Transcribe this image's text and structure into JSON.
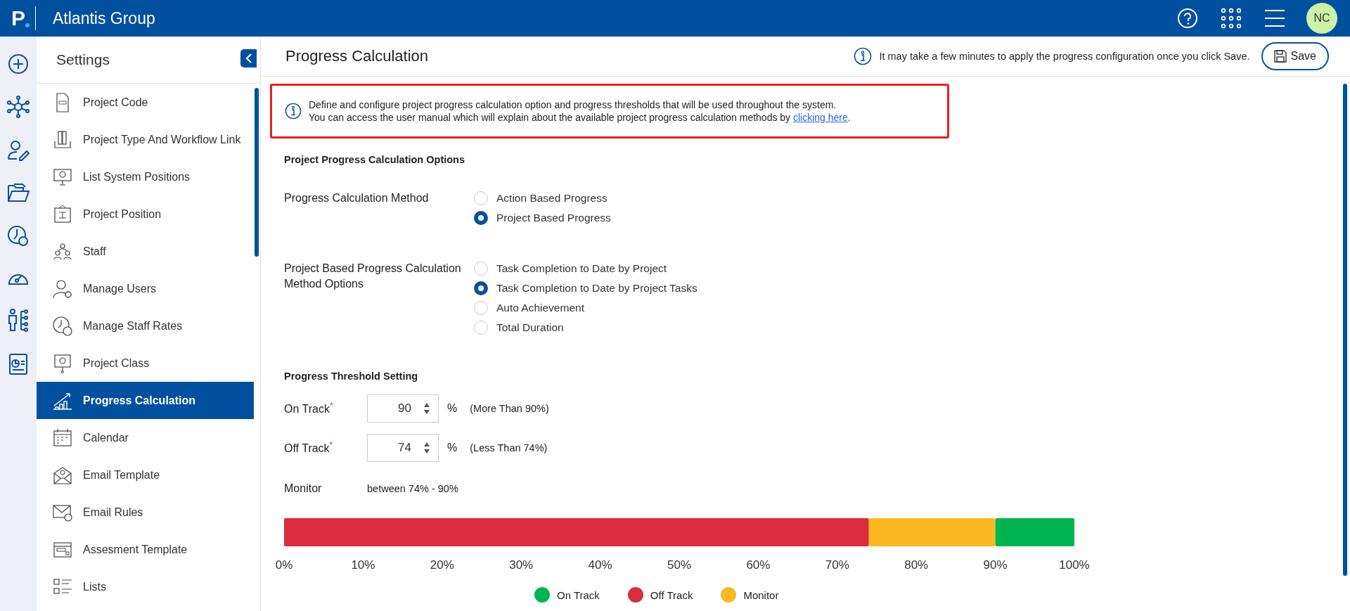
{
  "app": {
    "logo": "P",
    "title": "Atlantis Group",
    "avatar": "NC"
  },
  "sidebar": {
    "title": "Settings",
    "items": [
      {
        "label": "Project Code",
        "selected": false
      },
      {
        "label": "Project Type And Workflow Link",
        "selected": false
      },
      {
        "label": "List System Positions",
        "selected": false
      },
      {
        "label": "Project Position",
        "selected": false
      },
      {
        "label": "Staff",
        "selected": false
      },
      {
        "label": "Manage Users",
        "selected": false
      },
      {
        "label": "Manage Staff Rates",
        "selected": false
      },
      {
        "label": "Project Class",
        "selected": false
      },
      {
        "label": "Progress Calculation",
        "selected": true
      },
      {
        "label": "Calendar",
        "selected": false
      },
      {
        "label": "Email Template",
        "selected": false
      },
      {
        "label": "Email Rules",
        "selected": false
      },
      {
        "label": "Assesment Template",
        "selected": false
      },
      {
        "label": "Lists",
        "selected": false
      }
    ]
  },
  "page": {
    "title": "Progress Calculation",
    "notice": "It may take a few minutes to apply the progress configuration once you click Save.",
    "save": "Save"
  },
  "info": {
    "line_1": "Define and configure project progress calculation option and progress thresholds that will be used throughout the system.",
    "line_2": "You can access the user manual which will explain about the available project progress calculation methods by ",
    "link": "clicking here",
    "line_2_end": "."
  },
  "options": {
    "heading": "Project Progress Calculation Options",
    "groups": [
      {
        "label": "Progress Calculation Method",
        "options": [
          {
            "label": "Action Based Progress",
            "selected": false
          },
          {
            "label": "Project Based Progress",
            "selected": true
          }
        ]
      },
      {
        "label": "Project Based Progress Calculation Method Options",
        "options": [
          {
            "label": "Task Completion to Date by Project",
            "selected": false
          },
          {
            "label": "Task Completion to Date by Project Tasks",
            "selected": true
          },
          {
            "label": "Auto Achievement",
            "selected": false
          },
          {
            "label": "Total Duration",
            "selected": false
          }
        ]
      }
    ]
  },
  "thresholds": {
    "heading": "Progress Threshold Setting",
    "rows": [
      {
        "label": "On Track",
        "required_mark": "*",
        "value": "90",
        "unit": "%",
        "note": "(More Than 90%)"
      },
      {
        "label": "Off Track",
        "required_mark": "*",
        "value": "74",
        "unit": "%",
        "note": "(Less Than 74%)"
      }
    ],
    "monitor": {
      "label": "Monitor",
      "value": "between 74% - 90%"
    }
  },
  "chart_data": {
    "type": "bar",
    "orientation": "horizontal",
    "stacked": true,
    "series": [
      {
        "name": "On Track",
        "color": "#00b451",
        "values": [
          10
        ]
      },
      {
        "name": "Off Track",
        "color": "#d92c3d",
        "values": [
          74
        ]
      },
      {
        "name": "Monitor",
        "color": "#fbb81f",
        "values": [
          16
        ]
      }
    ],
    "xlim": [
      0,
      100
    ],
    "xticks": [
      {
        "value": 0,
        "label": "0%"
      },
      {
        "value": 10,
        "label": "10%"
      },
      {
        "value": 20,
        "label": "20%"
      },
      {
        "value": 30,
        "label": "30%"
      },
      {
        "value": 40,
        "label": "40%"
      },
      {
        "value": 50,
        "label": "50%"
      },
      {
        "value": 60,
        "label": "60%"
      },
      {
        "value": 70,
        "label": "70%"
      },
      {
        "value": 80,
        "label": "80%"
      },
      {
        "value": 90,
        "label": "90%"
      },
      {
        "value": 100,
        "label": "100%"
      }
    ]
  }
}
